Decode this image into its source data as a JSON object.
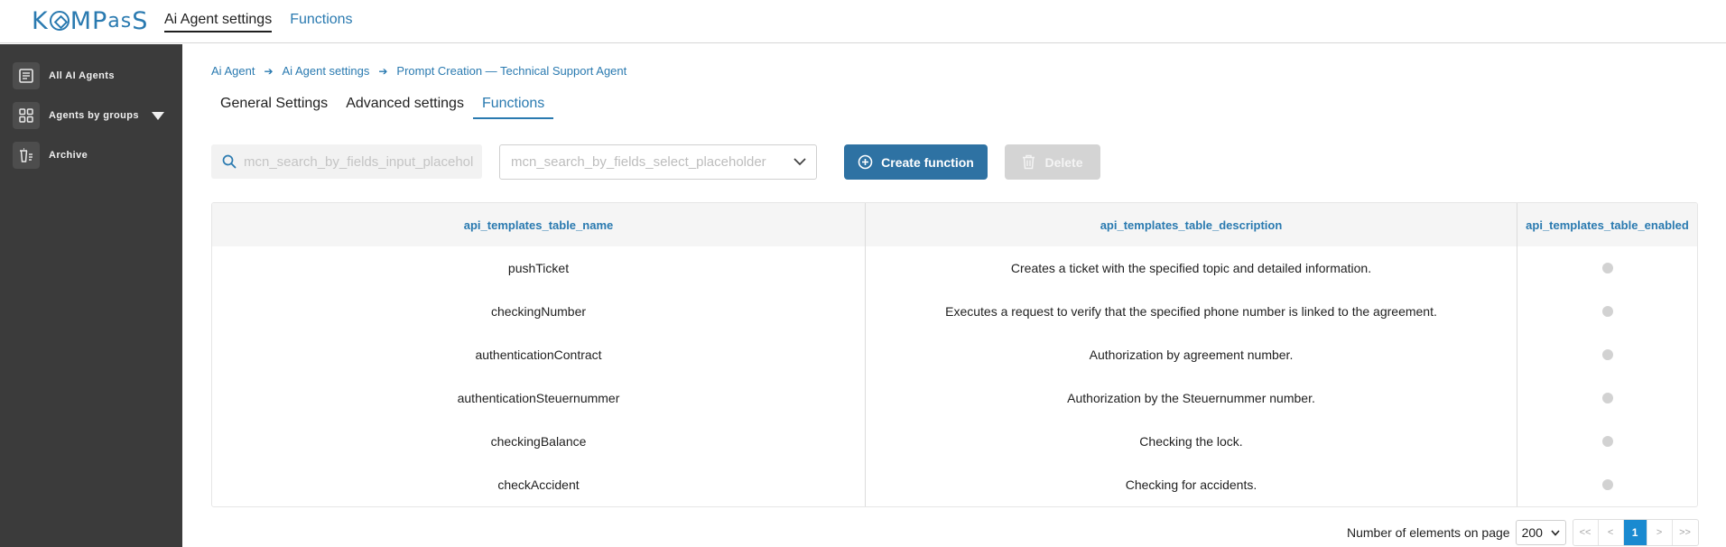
{
  "header": {
    "logo": "KOMPAS",
    "nav": [
      {
        "label": "Ai Agent settings"
      },
      {
        "label": "Functions"
      }
    ]
  },
  "sidebar": {
    "items": [
      {
        "label": "All AI Agents",
        "icon": "list-icon"
      },
      {
        "label": "Agents by groups",
        "icon": "grid-icon"
      },
      {
        "label": "Archive",
        "icon": "archive-icon"
      }
    ]
  },
  "breadcrumb": [
    "Ai Agent",
    "Ai Agent settings",
    "Prompt Creation — Technical Support Agent"
  ],
  "tabs": [
    "General Settings",
    "Advanced settings",
    "Functions"
  ],
  "filters": {
    "search_placeholder": "mcn_search_by_fields_input_placeholder",
    "select_placeholder": "mcn_search_by_fields_select_placeholder"
  },
  "actions": {
    "create": "Create function",
    "delete": "Delete"
  },
  "table": {
    "headers": [
      "api_templates_table_name",
      "api_templates_table_description",
      "api_templates_table_enabled"
    ],
    "rows": [
      {
        "name": "pushTicket",
        "description": "Creates a ticket with the specified topic and detailed information."
      },
      {
        "name": "checkingNumber",
        "description": "Executes a request to verify that the specified phone number is linked to the agreement."
      },
      {
        "name": "authenticationContract",
        "description": "Authorization by agreement number."
      },
      {
        "name": "authenticationSteuernummer",
        "description": "Authorization by the Steuernummer number."
      },
      {
        "name": "checkingBalance",
        "description": "Checking the lock."
      },
      {
        "name": "checkAccident",
        "description": "Checking for accidents."
      }
    ]
  },
  "pagination": {
    "label": "Number of elements on page",
    "page_size": "200",
    "first": "<<",
    "prev": "<",
    "current": "1",
    "next": ">",
    "last": ">>"
  },
  "colors": {
    "accent": "#2a7ab0",
    "button": "#2e72a3",
    "sidebar": "#3b3b3b",
    "current_page": "#1a8ad0"
  }
}
